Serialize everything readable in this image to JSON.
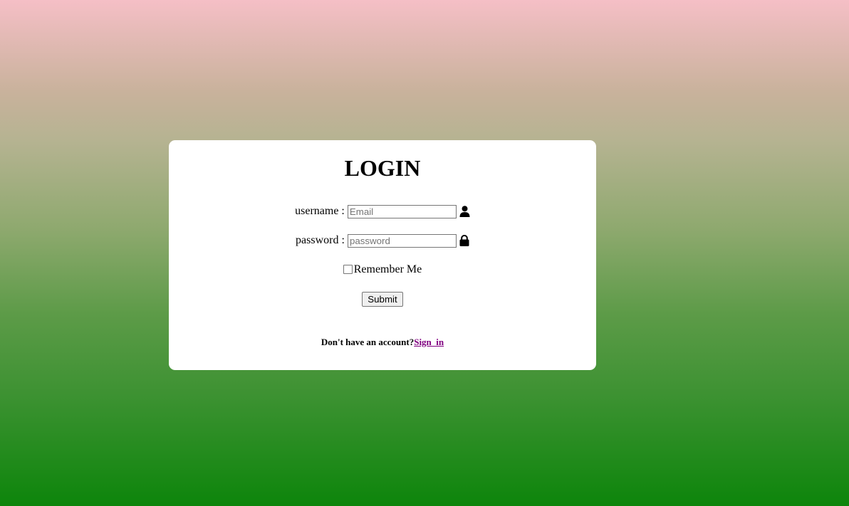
{
  "login_card": {
    "title": "LOGIN",
    "username": {
      "label": "username :",
      "value": "",
      "placeholder": "Email",
      "icon": "user-icon"
    },
    "password": {
      "label": "password :",
      "value": "",
      "placeholder": "password",
      "icon": "lock-icon"
    },
    "remember": {
      "label": "Remember Me",
      "checked": false
    },
    "submit_label": "Submit",
    "signup": {
      "prompt": "Don't have an account?",
      "link_label": "Sign_in"
    }
  },
  "colors": {
    "gradient_top": "#f5bfc6",
    "gradient_bottom": "#0d850b",
    "card_background": "#ffffff",
    "link_visited": "#800080"
  }
}
